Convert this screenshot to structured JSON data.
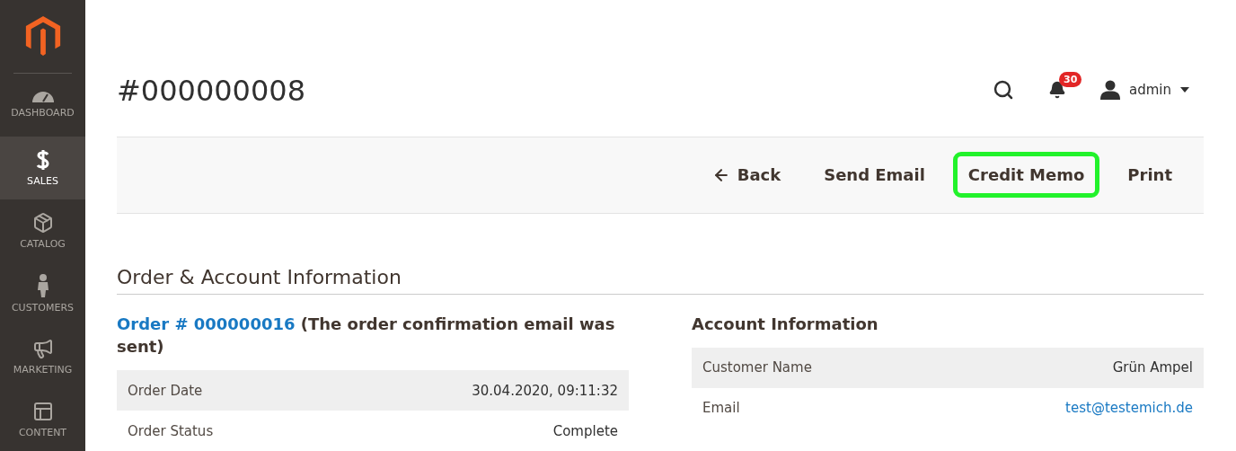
{
  "sidebar": {
    "items": [
      {
        "label": "DASHBOARD",
        "selected": false
      },
      {
        "label": "SALES",
        "selected": true
      },
      {
        "label": "CATALOG",
        "selected": false
      },
      {
        "label": "CUSTOMERS",
        "selected": false
      },
      {
        "label": "MARKETING",
        "selected": false
      },
      {
        "label": "CONTENT",
        "selected": false
      }
    ]
  },
  "header": {
    "title": "#000000008",
    "notifications": "30",
    "user": "admin"
  },
  "toolbar": {
    "buttons": [
      {
        "label": "Back",
        "kind": "back",
        "highlighted": false
      },
      {
        "label": "Send Email",
        "kind": "plain",
        "highlighted": false
      },
      {
        "label": "Credit Memo",
        "kind": "plain",
        "highlighted": true
      },
      {
        "label": "Print",
        "kind": "plain",
        "highlighted": false
      }
    ]
  },
  "section": {
    "title": "Order & Account Information",
    "order": {
      "link": "Order # 000000016",
      "note": "(The order confirmation email was sent)",
      "rows": [
        {
          "label": "Order Date",
          "value": "30.04.2020, 09:11:32"
        },
        {
          "label": "Order Status",
          "value": "Complete"
        }
      ]
    },
    "account": {
      "title": "Account Information",
      "rows": [
        {
          "label": "Customer Name",
          "value": "Grün Ampel",
          "kind": "text"
        },
        {
          "label": "Email",
          "value": "test@testemich.de",
          "kind": "link"
        }
      ]
    }
  }
}
